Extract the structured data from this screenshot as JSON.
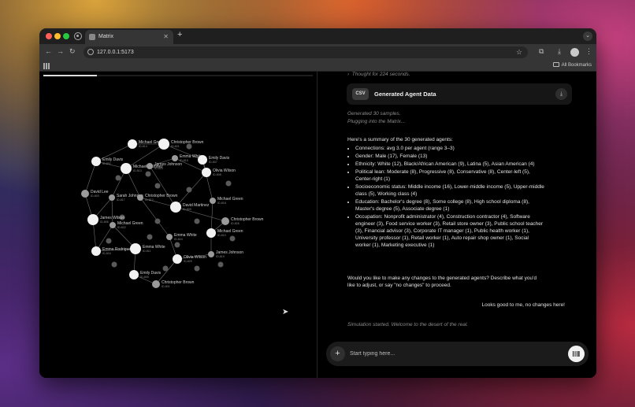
{
  "browser": {
    "tab_title": "Matrix",
    "url": "127.0.0.1:5173",
    "bookmarks_label": "All Bookmarks"
  },
  "progress": {
    "fraction": 0.2
  },
  "graph": {
    "nodes": [
      {
        "name": "Michael Green",
        "id": "ID-814"
      },
      {
        "name": "Christopher Brown",
        "id": "ID-821"
      },
      {
        "name": "Emma White",
        "id": "ID-815"
      },
      {
        "name": "Emily Davis",
        "id": "ID-807"
      },
      {
        "name": "Emily Davis",
        "id": "ID-802"
      },
      {
        "name": "Michael Martinez",
        "id": "ID-813"
      },
      {
        "name": "James Johnson",
        "id": "ID-820"
      },
      {
        "name": "Olivia Wilson",
        "id": "ID-808"
      },
      {
        "name": "David Lee",
        "id": "ID-803"
      },
      {
        "name": "Sarah Johnson",
        "id": "ID-817"
      },
      {
        "name": "Christopher Brown",
        "id": "ID-812"
      },
      {
        "name": "David Martinez",
        "id": "ID-809"
      },
      {
        "name": "Michael Green",
        "id": "ID-818"
      },
      {
        "name": "James Wilson",
        "id": "ID-806"
      },
      {
        "name": "Michael Green",
        "id": "ID-822"
      },
      {
        "name": "Christopher Brown",
        "id": "ID-826"
      },
      {
        "name": "Michael Green",
        "id": "ID-810"
      },
      {
        "name": "Emma White",
        "id": "ID-824"
      },
      {
        "name": "Emma Rodriguez",
        "id": "ID-816"
      },
      {
        "name": "Emma White",
        "id": "ID-811"
      },
      {
        "name": "James Johnson",
        "id": "ID-819"
      },
      {
        "name": "Olivia Wilson",
        "id": "ID-825"
      },
      {
        "name": "Emily Davis",
        "id": "ID-805"
      },
      {
        "name": "Christopher Brown",
        "id": "ID-801"
      }
    ]
  },
  "chat": {
    "thought": "Thought for 224 seconds.",
    "csv_badge": "CSV",
    "csv_title": "Generated Agent Data",
    "status_lines": [
      "Generated 30 samples.",
      "Plugging into the Matrix..."
    ],
    "summary_intro": "Here's a summary of the 30 generated agents:",
    "summary_items": [
      "Connections: avg 3.0 per agent (range 3–3)",
      "Gender: Male (17), Female (13)",
      "Ethnicity: White (12), Black/African American (9), Latina (5), Asian American (4)",
      "Political lean: Moderate (8), Progressive (8), Conservative (8), Center-left (5), Center-right (1)",
      "Socioeconomic status: Middle income (16), Lower-middle income (5), Upper-middle class (5), Working class (4)",
      "Education: Bachelor's degree (8), Some college (8), High school diploma (8), Master's degree (5), Associate degree (1)",
      "Occupation: Nonprofit administrator (4), Construction contractor (4), Software engineer (3), Food service worker (3), Retail store owner (3), Public school teacher (3), Financial advisor (3), Corporate IT manager (1), Public health worker (1), University professor (1), Retail worker (1), Auto repair shop owner (1), Social worker (1), Marketing executive (1)"
    ],
    "question": "Would you like to make any changes to the generated agents? Describe what you'd like to adjust, or say \"no changes\" to proceed.",
    "user_message": "Looks good to me, no changes here!",
    "simulation_status": "Simulation started. Welcome to the desert of the real.",
    "input_placeholder": "Start typing here..."
  },
  "icons": {
    "back": "arrow-left-icon",
    "forward": "arrow-right-icon",
    "reload": "reload-icon",
    "bookmark": "star-icon",
    "extensions": "puzzle-icon",
    "download": "download-icon",
    "attach": "plus-icon",
    "voice": "voice-icon"
  }
}
